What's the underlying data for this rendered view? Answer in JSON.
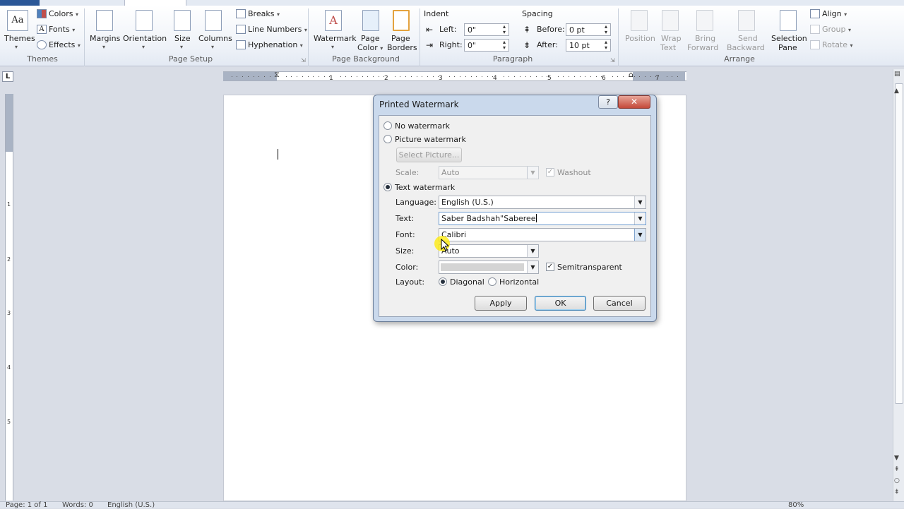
{
  "ribbon": {
    "themes": {
      "themes_label": "Themes",
      "colors_label": "Colors",
      "fonts_label": "Fonts",
      "effects_label": "Effects",
      "group_label": "Themes"
    },
    "page_setup": {
      "margins_label": "Margins",
      "orientation_label": "Orientation",
      "size_label": "Size",
      "columns_label": "Columns",
      "breaks_label": "Breaks",
      "line_numbers_label": "Line Numbers",
      "hyphenation_label": "Hyphenation",
      "group_label": "Page Setup"
    },
    "page_background": {
      "watermark_label": "Watermark",
      "page_color_label_1": "Page",
      "page_color_label_2": "Color",
      "page_borders_label_1": "Page",
      "page_borders_label_2": "Borders",
      "group_label": "Page Background"
    },
    "paragraph": {
      "indent_heading": "Indent",
      "spacing_heading": "Spacing",
      "left_label": "Left:",
      "left_value": "0\"",
      "right_label": "Right:",
      "right_value": "0\"",
      "before_label": "Before:",
      "before_value": "0 pt",
      "after_label": "After:",
      "after_value": "10 pt",
      "group_label": "Paragraph"
    },
    "arrange": {
      "position_label": "Position",
      "wrap_text_label_1": "Wrap",
      "wrap_text_label_2": "Text",
      "bring_forward_label_1": "Bring",
      "bring_forward_label_2": "Forward",
      "send_backward_label_1": "Send",
      "send_backward_label_2": "Backward",
      "selection_pane_label_1": "Selection",
      "selection_pane_label_2": "Pane",
      "align_label": "Align",
      "group_btn_label": "Group",
      "rotate_label": "Rotate",
      "group_label": "Arrange"
    }
  },
  "ruler": {
    "corner": "L",
    "h_ticks": [
      "1",
      "1",
      "2",
      "3",
      "4",
      "5",
      "6",
      "7"
    ],
    "v_ticks": [
      "1",
      "2",
      "3",
      "4",
      "5"
    ]
  },
  "status": {
    "page": "Page: 1 of 1",
    "words": "Words: 0",
    "language": "English (U.S.)",
    "zoom": "80%"
  },
  "dialog": {
    "title": "Printed Watermark",
    "help": "?",
    "close": "✕",
    "no_watermark": "No watermark",
    "picture_watermark": "Picture watermark",
    "select_picture": "Select Picture...",
    "scale_label": "Scale:",
    "scale_value": "Auto",
    "washout_label": "Washout",
    "text_watermark": "Text watermark",
    "language_label": "Language:",
    "language_value": "English (U.S.)",
    "text_label": "Text:",
    "text_value": "Saber Badshah\"Saberee",
    "font_label": "Font:",
    "font_value": "Calibri",
    "size_label": "Size:",
    "size_value": "Auto",
    "color_label": "Color:",
    "semitransparent_label": "Semitransparent",
    "layout_label": "Layout:",
    "diagonal_label": "Diagonal",
    "horizontal_label": "Horizontal",
    "apply": "Apply",
    "ok": "OK",
    "cancel": "Cancel",
    "selected_watermark_type": "Text watermark",
    "selected_layout": "Diagonal",
    "semitransparent_checked": true,
    "washout_checked": true
  },
  "colors": {
    "accent": "#2b5797",
    "dialog_frame": "#cad9ec",
    "close_button": "#c4493a"
  },
  "icons": [
    "themes-icon",
    "watermark-icon",
    "page-color-icon",
    "page-borders-icon",
    "selection-pane-icon",
    "close-icon",
    "help-icon"
  ]
}
